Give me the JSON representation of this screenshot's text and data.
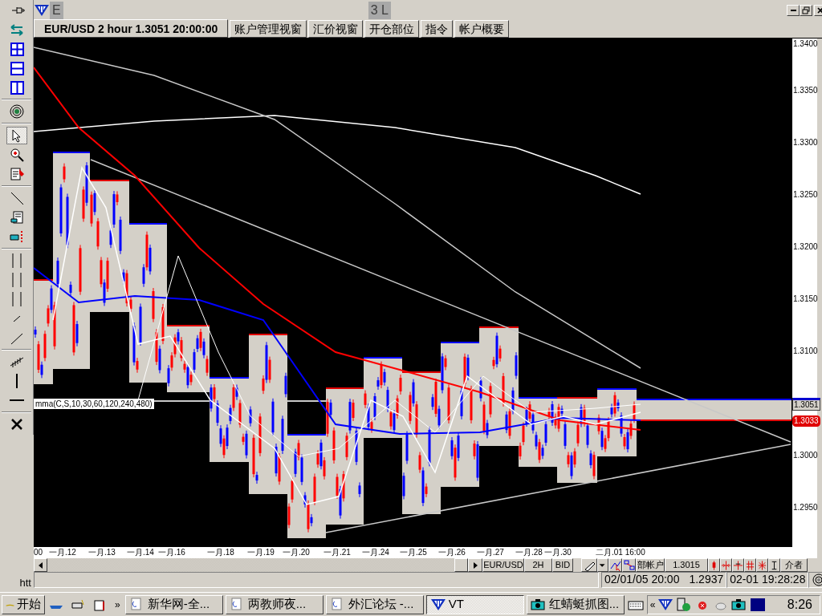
{
  "window": {
    "title_fragments": [
      "E",
      "3 L"
    ]
  },
  "tabs": [
    {
      "label": "EUR/USD 2 hour 1.3051 20:00:00",
      "selected": true
    },
    {
      "label": "账户管理视窗",
      "selected": false
    },
    {
      "label": "汇价视窗",
      "selected": false
    },
    {
      "label": "开仓部位",
      "selected": false
    },
    {
      "label": "指令",
      "selected": false
    },
    {
      "label": "帐户概要",
      "selected": false
    }
  ],
  "chart": {
    "indicator_label": "mma(C,S,10,30,60,120,240,480)",
    "price_ticks": [
      "1.3400",
      "1.3350",
      "1.3300",
      "1.3250",
      "1.3200",
      "1.3150",
      "1.3100",
      "1.3000",
      "1.2950"
    ],
    "price_markers": [
      {
        "text": "1.3051",
        "kind": "last"
      },
      {
        "text": "1.3033",
        "kind": "alert"
      }
    ],
    "date_labels": [
      "00",
      "一月.12",
      "一月.13",
      "一月.14",
      "一月.16",
      "一月.18",
      "一月.19",
      "一月.20",
      "一月.21",
      "一月.24",
      "一月.25",
      "一月.26",
      "一月.27",
      "一月.28",
      "一月.30",
      "二月.01 16:00"
    ]
  },
  "toolbar": {
    "symbol": "EUR/USD",
    "period": "2H",
    "side": "BID",
    "account": "部帐户",
    "price": "1.3015",
    "tail": "介者"
  },
  "status": {
    "url": "htt",
    "datetime": "02/01/05 20:00",
    "price": "1.2937",
    "clock": "02-01 19:28:28"
  },
  "taskbar": {
    "start": "开始",
    "more": "»",
    "tray_expand": "«",
    "time": "8:26",
    "tasks": [
      {
        "label": "新华网-全...",
        "selected": false
      },
      {
        "label": "两教师夜...",
        "selected": false
      },
      {
        "label": "外汇论坛 -...",
        "selected": false
      },
      {
        "label": "VT",
        "selected": true
      },
      {
        "label": "红蜻蜓抓图...",
        "selected": false
      }
    ]
  }
}
